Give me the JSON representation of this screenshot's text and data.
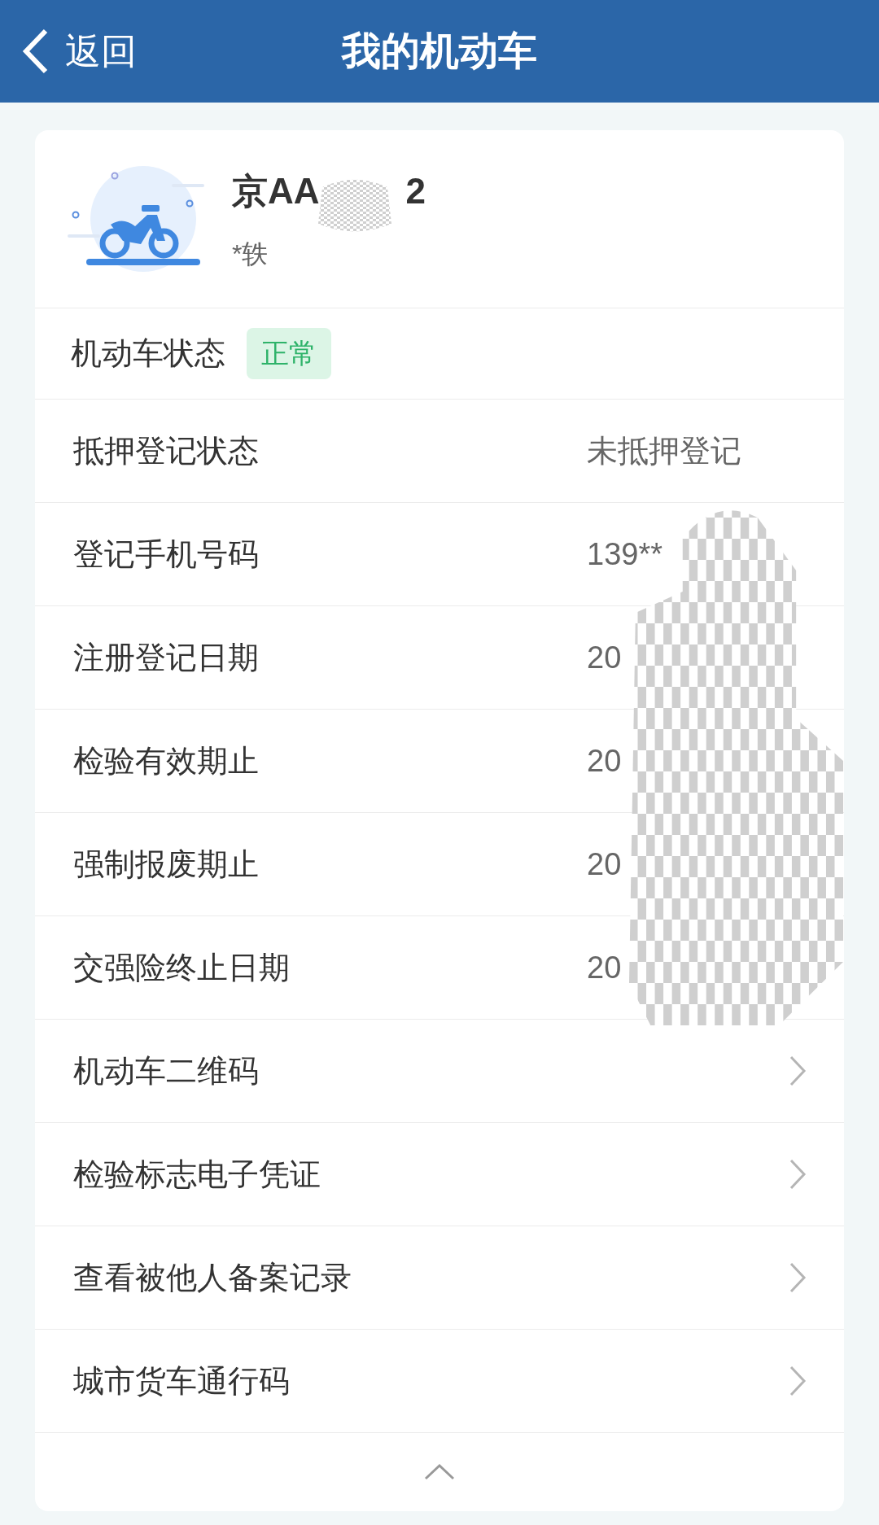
{
  "header": {
    "back_label": "返回",
    "title": "我的机动车"
  },
  "vehicle": {
    "plate_start": "京AA",
    "plate_end": "2",
    "owner": "*轶"
  },
  "status": {
    "label": "机动车状态",
    "badge": "正常"
  },
  "rows": [
    {
      "kind": "value",
      "label": "抵押登记状态",
      "value": "未抵押登记"
    },
    {
      "kind": "value",
      "label": "登记手机号码",
      "value": "139**"
    },
    {
      "kind": "value",
      "label": "注册登记日期",
      "value": "20"
    },
    {
      "kind": "value",
      "label": "检验有效期止",
      "value": "20"
    },
    {
      "kind": "value",
      "label": "强制报废期止",
      "value": "20"
    },
    {
      "kind": "value",
      "label": "交强险终止日期",
      "value": "20"
    },
    {
      "kind": "link",
      "label": "机动车二维码"
    },
    {
      "kind": "link",
      "label": "检验标志电子凭证"
    },
    {
      "kind": "link",
      "label": "查看被他人备案记录"
    },
    {
      "kind": "link",
      "label": "城市货车通行码"
    }
  ]
}
